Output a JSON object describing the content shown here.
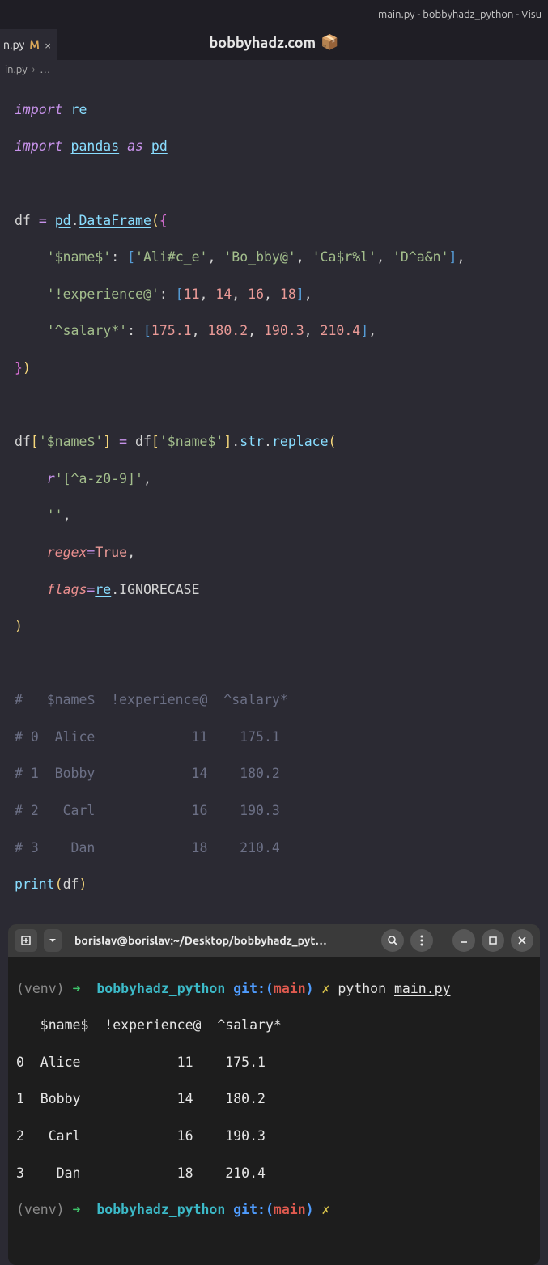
{
  "window": {
    "title": "main.py - bobbyhadz_python - Visu"
  },
  "tab": {
    "filename": "n.py",
    "mod_flag": "M",
    "close": "×"
  },
  "watermark": {
    "text": "bobbyhadz.com",
    "icon": "📦"
  },
  "breadcrumb": {
    "file": "in.py",
    "sep": "›",
    "dots": "…"
  },
  "code": {
    "l1_import": "import",
    "l1_re": "re",
    "l2_import": "import",
    "l2_pandas": "pandas",
    "l2_as": "as",
    "l2_pd": "pd",
    "l4_df": "df",
    "l4_eq": "=",
    "l4_pd": "pd",
    "l4_dot": ".",
    "l4_dataframe": "DataFrame",
    "l4_open": "(",
    "l4_brace": "{",
    "l5_key": "'$name$'",
    "l5_colon": ":",
    "l5_lb": "[",
    "l5_v1": "'Ali#c_e'",
    "l5_v2": "'Bo_bby@'",
    "l5_v3": "'Ca$r%l'",
    "l5_v4": "'D^a&n'",
    "l5_rb": "]",
    "l5_comma": ",",
    "l6_key": "'!experience@'",
    "l6_colon": ":",
    "l6_lb": "[",
    "l6_v1": "11",
    "l6_v2": "14",
    "l6_v3": "16",
    "l6_v4": "18",
    "l6_rb": "]",
    "l6_comma": ",",
    "l7_key": "'^salary*'",
    "l7_colon": ":",
    "l7_lb": "[",
    "l7_v1": "175.1",
    "l7_v2": "180.2",
    "l7_v3": "190.3",
    "l7_v4": "210.4",
    "l7_rb": "]",
    "l7_comma": ",",
    "l8_brace": "}",
    "l8_close": ")",
    "l10_df": "df",
    "l10_lb": "[",
    "l10_key": "'$name$'",
    "l10_rb": "]",
    "l10_eq": "=",
    "l10_df2": "df",
    "l10_lb2": "[",
    "l10_key2": "'$name$'",
    "l10_rb2": "]",
    "l10_dot": ".",
    "l10_str": "str",
    "l10_dot2": ".",
    "l10_replace": "replace",
    "l10_open": "(",
    "l11_r": "r",
    "l11_pat": "'[^a-z0-9]'",
    "l11_comma": ",",
    "l12_empty": "''",
    "l12_comma": ",",
    "l13_regex": "regex",
    "l13_eq": "=",
    "l13_true": "True",
    "l13_comma": ",",
    "l14_flags": "flags",
    "l14_eq": "=",
    "l14_re": "re",
    "l14_dot": ".",
    "l14_ign": "IGNORECASE",
    "l15_close": ")",
    "c1": "#   $name$  !experience@  ^salary*",
    "c2": "# 0  Alice            11    175.1",
    "c3": "# 1  Bobby            14    180.2",
    "c4": "# 2   Carl            16    190.3",
    "c5": "# 3    Dan            18    210.4",
    "l22_print": "print",
    "l22_open": "(",
    "l22_df": "df",
    "l22_close": ")"
  },
  "terminal": {
    "title": "borislav@borislav:~/Desktop/bobbyhadz_pyt…",
    "venv": "(venv)",
    "arrow": "➜",
    "dir": "bobbyhadz_python",
    "git_pre": "git:(",
    "git_branch": "main",
    "git_post": ")",
    "dirty": "✗",
    "cmd_py": "python",
    "cmd_file": "main.py",
    "o1": "   $name$  !experience@  ^salary*",
    "o2": "0  Alice            11    175.1",
    "o3": "1  Bobby            14    180.2",
    "o4": "2   Carl            16    190.3",
    "o5": "3    Dan            18    210.4"
  }
}
